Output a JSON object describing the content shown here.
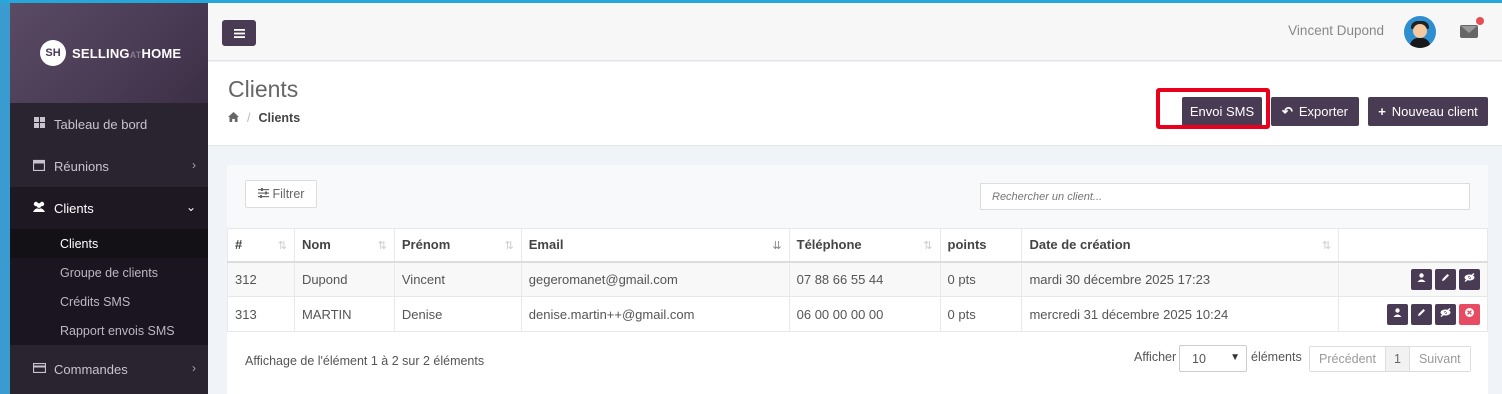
{
  "brand": {
    "logo_mark": "SH",
    "name_part1": "SELLING",
    "name_at": "AT",
    "name_part2": "HOME"
  },
  "sidebar": {
    "items": [
      {
        "label": "Tableau de bord",
        "icon": "dashboard-icon"
      },
      {
        "label": "Réunions",
        "icon": "calendar-icon"
      },
      {
        "label": "Clients",
        "icon": "users-icon"
      },
      {
        "label": "Commandes",
        "icon": "credit-card-icon"
      }
    ],
    "clients_sub": [
      {
        "label": "Clients"
      },
      {
        "label": "Groupe de clients"
      },
      {
        "label": "Crédits SMS"
      },
      {
        "label": "Rapport envois SMS"
      }
    ]
  },
  "header": {
    "user_name": "Vincent Dupond"
  },
  "page": {
    "title": "Clients",
    "breadcrumb_current": "Clients",
    "buttons": {
      "sms": "Envoi SMS",
      "export": "Exporter",
      "new": "Nouveau client"
    }
  },
  "filters": {
    "filter_label": "Filtrer",
    "search_placeholder": "Rechercher un client..."
  },
  "table": {
    "columns": [
      "#",
      "Nom",
      "Prénom",
      "Email",
      "Téléphone",
      "points",
      "Date de création",
      ""
    ],
    "rows": [
      {
        "id": "312",
        "nom": "Dupond",
        "prenom": "Vincent",
        "email": "gegeromanet@gmail.com",
        "telephone": "07 88 66 55 44",
        "points": "0 pts",
        "date": "mardi 30 décembre 2025 17:23"
      },
      {
        "id": "313",
        "nom": "MARTIN",
        "prenom": "Denise",
        "email": "denise.martin++@gmail.com",
        "telephone": "06 00 00 00 00",
        "points": "0 pts",
        "date": "mercredi 31 décembre 2025 10:24"
      }
    ]
  },
  "footer": {
    "info": "Affichage de l'élément 1 à 2 sur 2 éléments",
    "show_label": "Afficher",
    "page_length": "10",
    "elements_label": "éléments",
    "prev": "Précédent",
    "page": "1",
    "next": "Suivant"
  },
  "colors": {
    "primary": "#4a3b55",
    "sidebar": "#2a2330",
    "highlight": "#e8001c",
    "delete": "#e84c63",
    "accent_border": "#3a9bd1"
  }
}
